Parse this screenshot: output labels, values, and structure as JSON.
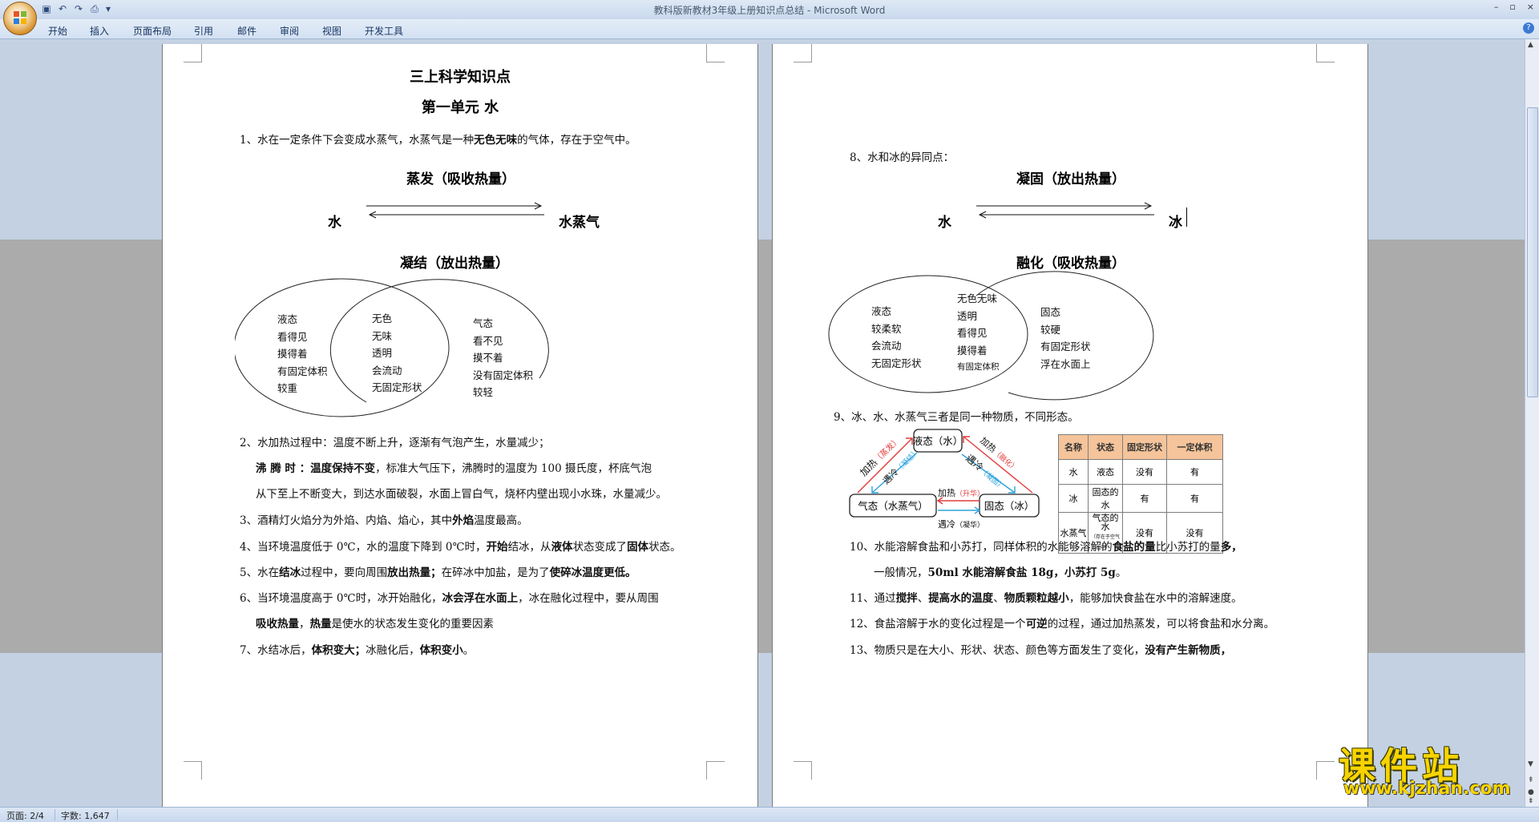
{
  "window": {
    "title": "教科版新教材3年级上册知识点总结 - Microsoft Word",
    "controls": [
      "–",
      "▫",
      "×"
    ]
  },
  "ribbon": {
    "tabs": [
      "开始",
      "插入",
      "页面布局",
      "引用",
      "邮件",
      "审阅",
      "视图",
      "开发工具"
    ],
    "help": "?"
  },
  "page1": {
    "title": "三上科学知识点",
    "unit": "第一单元  水",
    "p1": {
      "pre": "1、水在一定条件下会变成水蒸气，水蒸气是一种",
      "bold": "无色无味",
      "post": "的气体，存在于空气中。"
    },
    "diagram1": {
      "top_label": "蒸发（吸收热量）",
      "left": "水",
      "right": "水蒸气",
      "bottom_label": "凝结（放出热量）"
    },
    "venn1": {
      "left": [
        "液态",
        "看得见",
        "摸得着",
        "有固定体积",
        "较重"
      ],
      "middle": [
        "无色",
        "无味",
        "透明",
        "会流动",
        "无固定形状"
      ],
      "right": [
        "气态",
        "看不见",
        "摸不着",
        "没有固定体积",
        "较轻"
      ]
    },
    "p2": "2、水加热过程中：温度不断上升，逐渐有气泡产生，水量减少；",
    "p2b": {
      "b1": "沸 腾 时 ：",
      "b2": "温度保持不变",
      "post": "，标准大气压下，沸腾时的温度为 100 摄氏度，杯底气泡"
    },
    "p2c": "从下至上不断变大，到达水面破裂，水面上冒白气，烧杯内壁出现小水珠，水量减少。",
    "p3": {
      "pre": "3、酒精灯火焰分为外焰、内焰、焰心，其中",
      "bold": "外焰",
      "post": "温度最高。"
    },
    "p4": {
      "pre": "4、当环境温度低于 0℃，水的温度下降到 0℃时，",
      "b1": "开始",
      "m1": "结冰，从",
      "b2": "液体",
      "m2": "状态变成了",
      "b3": "固体",
      "post": "状态。"
    },
    "p5": {
      "pre": "5、水在",
      "b1": "结冰",
      "m1": "过程中，要向周围",
      "b2": "放出热量；",
      "m2": "在碎冰中加盐，是为了",
      "b3": "使碎冰温度更低。"
    },
    "p6": {
      "pre": "6、当环境温度高于 0℃时，冰开始融化，",
      "b1": "冰会浮在水面上",
      "post": "，冰在融化过程中，要从周围"
    },
    "p6b": {
      "b1": "吸收热量",
      "m1": "，",
      "b2": "热量",
      "post": "是使水的状态发生变化的重要因素"
    },
    "p7": {
      "pre": "7、水结冰后，",
      "b1": "体积变大；",
      "m1": "冰融化后，",
      "b2": "体积变小",
      "post": "。"
    }
  },
  "page2": {
    "p8": "8、水和冰的异同点：",
    "diagram2": {
      "top_label": "凝固（放出热量）",
      "left": "水",
      "right": "冰",
      "bottom_label": "融化（吸收热量）"
    },
    "venn2": {
      "left": [
        "液态",
        "较柔软",
        "会流动",
        "无固定形状"
      ],
      "middle": [
        "无色无味",
        "透明",
        "看得见",
        "摸得着",
        "有固定体积"
      ],
      "right": [
        "固态",
        "较硬",
        "有固定形状",
        "浮在水面上"
      ]
    },
    "p9": "9、冰、水、水蒸气三者是同一种物质，不同形态。",
    "cycle": {
      "liquid": "液态（水）",
      "gas": "气态（水蒸气）",
      "solid": "固态（冰）",
      "heat_evap": "加热",
      "heat_evap_note": "（蒸发）",
      "cool_cond": "遇冷",
      "cool_cond_note": "（凝结）",
      "heat_melt": "加热",
      "heat_melt_note": "（融化）",
      "cool_freeze": "遇冷",
      "cool_freeze_note": "（凝固）",
      "heat_sub": "加热",
      "heat_sub_note": "（升华）",
      "cool_dep": "遇冷",
      "cool_dep_note": "（凝华）"
    },
    "table": {
      "headers": [
        "名称",
        "状态",
        "固定形状",
        "一定体积"
      ],
      "rows": [
        [
          "水",
          "液态",
          "没有",
          "有"
        ],
        [
          "冰",
          "固态的水",
          "有",
          "有"
        ],
        [
          "水蒸气",
          "气态的水",
          "没有",
          "没有"
        ]
      ],
      "row3_note": "（存在于空气中）"
    },
    "p10": {
      "pre": "10、水能溶解食盐和小苏打，同样体积的水能够溶解的",
      "b1": "食盐的量",
      "m1": "比小苏打的量",
      "b2": "多，"
    },
    "p10b": {
      "pre": "一般情况，",
      "b1": "50ml 水能溶解食盐 18g，小苏打 5g",
      "post": "。"
    },
    "p11": {
      "pre": "11、通过",
      "b1": "搅拌",
      "m1": "、",
      "b2": "提高水的温度",
      "m2": "、",
      "b3": "物质颗粒越小",
      "post": "，能够加快食盐在水中的溶解速度。"
    },
    "p12": {
      "pre": "12、食盐溶解于水的变化过程是一个",
      "b1": "可逆",
      "post": "的过程，通过加热蒸发，可以将食盐和水分离。"
    },
    "p13": {
      "pre": "13、物质只是在大小、形状、状态、颜色等方面发生了变化，",
      "b1": "没有产生新物质，"
    }
  },
  "status": {
    "page": "页面: 2/4",
    "words": "字数: 1,647"
  },
  "watermark": {
    "big": "课件站",
    "url": "www.kjzhan.com"
  }
}
